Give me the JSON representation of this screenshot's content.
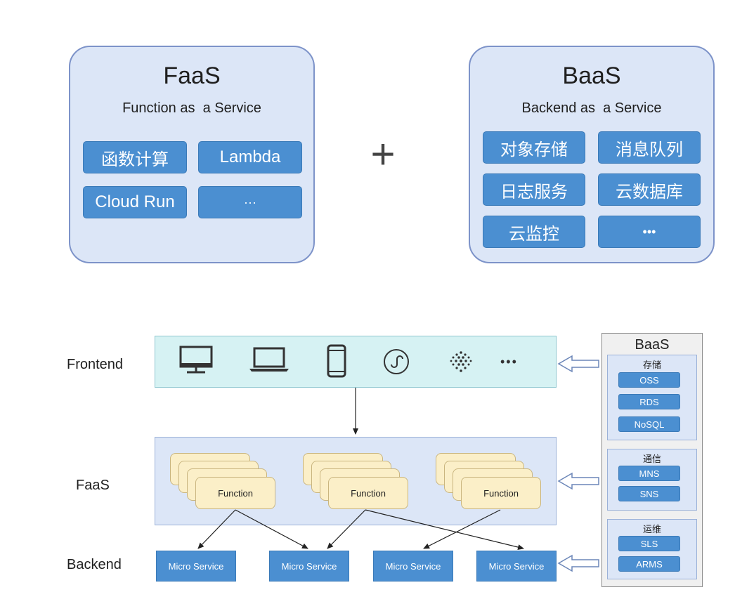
{
  "top": {
    "faas": {
      "title": "FaaS",
      "subtitle": "Function as  a Service",
      "chips": [
        "函数计算",
        "Lambda",
        "Cloud Run",
        "···"
      ]
    },
    "plus": "+",
    "baas": {
      "title": "BaaS",
      "subtitle": "Backend as  a Service",
      "chips": [
        "对象存储",
        "消息队列",
        "日志服务",
        "云数据库",
        "云监控",
        "•••"
      ]
    }
  },
  "bottom": {
    "labels": {
      "frontend": "Frontend",
      "faas": "FaaS",
      "backend": "Backend"
    },
    "frontend_icons": [
      "desktop-icon",
      "laptop-icon",
      "phone-icon",
      "mini-program-icon",
      "iot-icon",
      "more-icon"
    ],
    "frontend_more": "•••",
    "functions": [
      "Function",
      "Function",
      "Function"
    ],
    "micro_services": [
      "Micro Service",
      "Micro Service",
      "Micro Service",
      "Micro Service"
    ],
    "baas": {
      "title": "BaaS",
      "groups": [
        {
          "title": "存储",
          "items": [
            "OSS",
            "RDS",
            "NoSQL"
          ]
        },
        {
          "title": "通信",
          "items": [
            "MNS",
            "SNS"
          ]
        },
        {
          "title": "运维",
          "items": [
            "SLS",
            "ARMS"
          ]
        }
      ]
    }
  },
  "colors": {
    "panel_fill": "#dce6f7",
    "panel_border": "#7d93c9",
    "chip_blue": "#4b8fd1",
    "frontend_fill": "#d6f2f3",
    "function_card": "#fbefc8"
  }
}
